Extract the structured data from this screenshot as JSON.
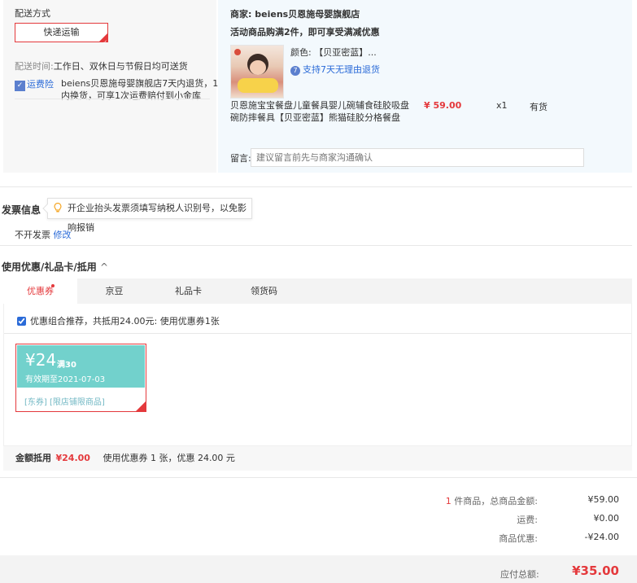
{
  "shipping": {
    "title": "配送方式",
    "method_label": "快递运输",
    "delivery_time_label": "配送时间:",
    "delivery_time_value": "工作日、双休日与节假日均可送货",
    "insurance_badge": "运费险",
    "insurance_text_line1": "beiens贝恩施母婴旗舰店7天内退货，15天",
    "insurance_text_line2": "内换货，可享1次运费赔付到小金库"
  },
  "merchant": {
    "label": "商家:",
    "name": "beiens贝恩施母婴旗舰店",
    "promo": "活动商品购满2件，即可享受满减优惠",
    "color_label": "颜色:",
    "color_value": "【贝亚密蓝】...",
    "return_policy": "支持7天无理由退货",
    "product_name_line1": "贝恩施宝宝餐盘儿童餐具婴儿碗辅食硅胶吸盘",
    "product_name_line2": "碗防摔餐具【贝亚密蓝】熊猫硅胶分格餐盘",
    "price": "¥ 59.00",
    "quantity": "x1",
    "stock": "有货",
    "remark_label": "留言:",
    "remark_placeholder": "建议留言前先与商家沟通确认"
  },
  "invoice": {
    "title": "发票信息",
    "tip": "开企业抬头发票须填写纳税人识别号，以免影响报销",
    "status": "不开发票",
    "edit_link": "修改"
  },
  "discount": {
    "title": "使用优惠/礼品卡/抵用",
    "tabs": [
      {
        "label": "优惠券"
      },
      {
        "label": "京豆"
      },
      {
        "label": "礼品卡"
      },
      {
        "label": "领货码"
      }
    ],
    "recommend_text": "优惠组合推荐，共抵用24.00元: 使用优惠券1张",
    "coupon": {
      "amount": "¥24",
      "condition": "满30",
      "expiry": "有效期至2021-07-03",
      "tag1": "[东券]",
      "tag2": "[限店铺限商品]"
    },
    "deduct_label": "金额抵用",
    "deduct_amount": "¥24.00",
    "deduct_detail": "使用优惠券 1 张，优惠 24.00 元"
  },
  "summary": {
    "item_count": "1",
    "item_count_suffix": "件商品，总商品金额:",
    "goods_total": "¥59.00",
    "shipping_label": "运费:",
    "shipping_fee": "¥0.00",
    "discount_label": "商品优惠:",
    "discount_value": "-¥24.00",
    "payable_label": "应付总额:",
    "payable_value": "¥35.00"
  },
  "colors": {
    "accent_red": "#e4393c",
    "coupon_teal": "#72d1cc",
    "link_blue": "#2b6bd8"
  }
}
